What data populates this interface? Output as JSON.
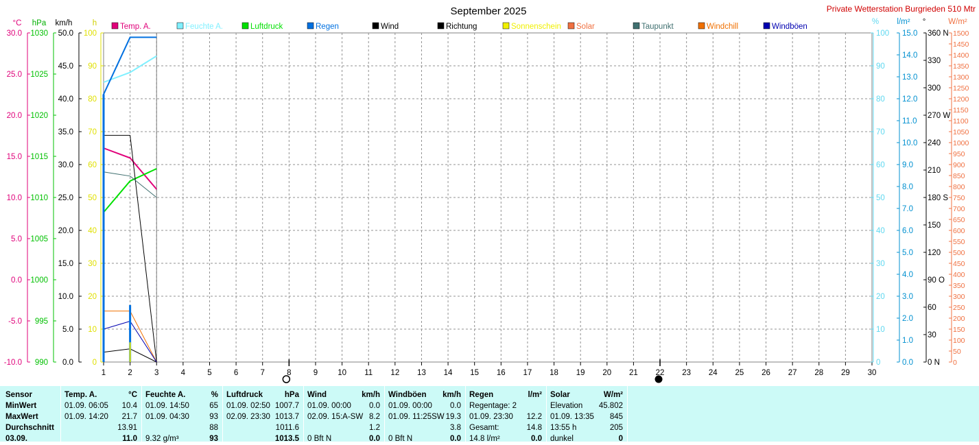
{
  "title": "September 2025",
  "station": "Private Wetterstation Burgrieden 510 Mtr",
  "axis_units": {
    "temp": "°C",
    "pressure": "hPa",
    "wind": "km/h",
    "sun": "h",
    "humidity": "%",
    "rain": "l/m²",
    "direction": "°",
    "solar": "W/m²"
  },
  "legend": [
    {
      "label": "Temp. A.",
      "color": "#e0007a"
    },
    {
      "label": "Feuchte A.",
      "color": "#80f0ff"
    },
    {
      "label": "Luftdruck",
      "color": "#00e000"
    },
    {
      "label": "Regen",
      "color": "#0070e0"
    },
    {
      "label": "Wind",
      "color": "#000000"
    },
    {
      "label": "Richtung",
      "color": "#000000"
    },
    {
      "label": "Sonnenschein",
      "color": "#f0f000"
    },
    {
      "label": "Solar",
      "color": "#f07040"
    },
    {
      "label": "Taupunkt",
      "color": "#407070"
    },
    {
      "label": "Windchill",
      "color": "#f07000"
    },
    {
      "label": "Windböen",
      "color": "#0000b0"
    }
  ],
  "chart_data": {
    "type": "line",
    "x": [
      1,
      2,
      3
    ],
    "x_ticks": [
      "1",
      "2",
      "3",
      "4",
      "5",
      "6",
      "7",
      "8",
      "9",
      "10",
      "11",
      "12",
      "13",
      "14",
      "15",
      "16",
      "17",
      "18",
      "19",
      "20",
      "21",
      "22",
      "23",
      "24",
      "25",
      "26",
      "27",
      "28",
      "29",
      "30"
    ],
    "grid": true,
    "axes": {
      "temp": {
        "range": [
          -10,
          30
        ],
        "ticks": [
          "30.0",
          "25.0",
          "20.0",
          "15.0",
          "10.0",
          "5.0",
          "0.0",
          "-5.0",
          "-10.0"
        ]
      },
      "pressure": {
        "range": [
          990,
          1030
        ],
        "ticks": [
          "1030",
          "1025",
          "1020",
          "1015",
          "1010",
          "1005",
          "1000",
          "995",
          "990"
        ]
      },
      "wind": {
        "range": [
          0,
          50
        ],
        "ticks": [
          "50.0",
          "45.0",
          "40.0",
          "35.0",
          "30.0",
          "25.0",
          "20.0",
          "15.0",
          "10.0",
          "5.0",
          "0.0"
        ]
      },
      "sun": {
        "range": [
          0,
          100
        ],
        "ticks": [
          "100",
          "90",
          "80",
          "70",
          "60",
          "50",
          "40",
          "30",
          "20",
          "10",
          "0"
        ]
      },
      "humidity": {
        "range": [
          0,
          100
        ],
        "ticks": [
          "100",
          "90",
          "80",
          "70",
          "60",
          "50",
          "40",
          "30",
          "20",
          "10",
          "0"
        ]
      },
      "rain": {
        "range": [
          0,
          15
        ],
        "ticks": [
          "15.0",
          "14.0",
          "13.0",
          "12.0",
          "11.0",
          "10.0",
          "9.0",
          "8.0",
          "7.0",
          "6.0",
          "5.0",
          "4.0",
          "3.0",
          "2.0",
          "1.0",
          "0.0"
        ]
      },
      "direction": {
        "range": [
          0,
          360
        ],
        "ticks": [
          "360 N",
          "330",
          "300",
          "270 W",
          "240",
          "210",
          "180 S",
          "150",
          "120",
          "90 O",
          "60",
          "30",
          "0 N"
        ]
      },
      "solar": {
        "range": [
          0,
          1500
        ],
        "ticks": [
          "1500",
          "1450",
          "1400",
          "1350",
          "1300",
          "1250",
          "1200",
          "1150",
          "1100",
          "1050",
          "1000",
          "950",
          "900",
          "850",
          "800",
          "750",
          "700",
          "650",
          "600",
          "550",
          "500",
          "450",
          "400",
          "350",
          "300",
          "250",
          "200",
          "150",
          "100",
          "50",
          "0"
        ]
      }
    },
    "series": [
      {
        "name": "Temp. A.",
        "axis": "temp",
        "x": [
          1,
          2,
          3
        ],
        "y": [
          16.0,
          14.8,
          11.0
        ]
      },
      {
        "name": "Feuchte A.",
        "axis": "humidity",
        "x": [
          1,
          2,
          3
        ],
        "y": [
          85,
          88,
          93
        ]
      },
      {
        "name": "Luftdruck",
        "axis": "pressure",
        "x": [
          1,
          2,
          3
        ],
        "y": [
          1008.2,
          1012.0,
          1013.5
        ]
      },
      {
        "name": "Regen",
        "axis": "rain",
        "x": [
          1,
          1,
          2,
          3
        ],
        "y": [
          0,
          12.2,
          14.8,
          14.8
        ]
      },
      {
        "name": "Wind",
        "axis": "wind",
        "x": [
          1,
          2,
          3
        ],
        "y": [
          1.5,
          2.0,
          0
        ]
      },
      {
        "name": "Richtung",
        "axis": "direction",
        "x": [
          1,
          2,
          3
        ],
        "y": [
          248,
          248,
          0
        ]
      },
      {
        "name": "Taupunkt",
        "axis": "temp",
        "x": [
          1,
          2,
          3
        ],
        "y": [
          13.1,
          12.6,
          10.0
        ]
      },
      {
        "name": "Windchill",
        "axis": "temp",
        "x": [
          1,
          2,
          3
        ],
        "y": [
          -3.8,
          -3.8,
          -10.0
        ]
      },
      {
        "name": "Windböen",
        "axis": "wind",
        "x": [
          1,
          2,
          3
        ],
        "y": [
          5.0,
          6.2,
          0
        ]
      }
    ],
    "rain_bars": [
      {
        "x": 1,
        "value": 12.2
      },
      {
        "x": 2,
        "value": 2.6
      }
    ],
    "sun_bars": [
      {
        "x": 2,
        "value": 6
      }
    ],
    "moon_phases": [
      {
        "x": 8,
        "phase": "full"
      },
      {
        "x": 22,
        "phase": "new"
      }
    ]
  },
  "table": {
    "sensor": {
      "header": "Sensor",
      "rows": [
        "MinWert",
        "MaxWert",
        "Durchschnitt",
        "03.09."
      ]
    },
    "temp": {
      "header": "Temp. A.",
      "unit": "°C",
      "rows": [
        [
          "01.09.  06:05",
          "10.4"
        ],
        [
          "01.09.  14:20",
          "21.7"
        ],
        [
          "",
          "13.91"
        ],
        [
          "",
          "11.0"
        ]
      ]
    },
    "humidity": {
      "header": "Feuchte A.",
      "unit": "%",
      "rows": [
        [
          "01.09.  14:50",
          "65"
        ],
        [
          "01.09.  04:30",
          "93"
        ],
        [
          "",
          "88"
        ],
        [
          "9.32 g/m³",
          "93"
        ]
      ]
    },
    "pressure": {
      "header": "Luftdruck",
      "unit": "hPa",
      "rows": [
        [
          "01.09.  02:50",
          "1007.7"
        ],
        [
          "02.09.  23:30",
          "1013.7"
        ],
        [
          "",
          "1011.6"
        ],
        [
          "",
          "1013.5"
        ]
      ]
    },
    "wind": {
      "header": "Wind",
      "unit": "km/h",
      "rows": [
        [
          "01.09.  00:00",
          "0.0"
        ],
        [
          "02.09.  15:A-SW",
          "8.2"
        ],
        [
          "",
          "1.2"
        ],
        [
          "0 Bft N",
          "0.0"
        ]
      ]
    },
    "gusts": {
      "header": "Windböen",
      "unit": "km/h",
      "rows": [
        [
          "01.09.  00:00",
          "0.0"
        ],
        [
          "01.09.  11:25SW",
          "19.3"
        ],
        [
          "",
          "3.8"
        ],
        [
          "0 Bft N",
          "0.0"
        ]
      ]
    },
    "rain": {
      "header": "Regen",
      "unit": "l/m²",
      "rows": [
        [
          "Regentage: 2",
          ""
        ],
        [
          "01.09.  23:30",
          "12.2"
        ],
        [
          "Gesamt:",
          "14.8"
        ],
        [
          "14.8 l/m²",
          "0.0"
        ]
      ]
    },
    "solar": {
      "header": "Solar",
      "unit": "W/m²",
      "rows": [
        [
          "Elevation",
          "45.802"
        ],
        [
          "01.09.  13:35",
          "845"
        ],
        [
          "13:55 h",
          "205"
        ],
        [
          "dunkel",
          "0"
        ]
      ]
    }
  }
}
